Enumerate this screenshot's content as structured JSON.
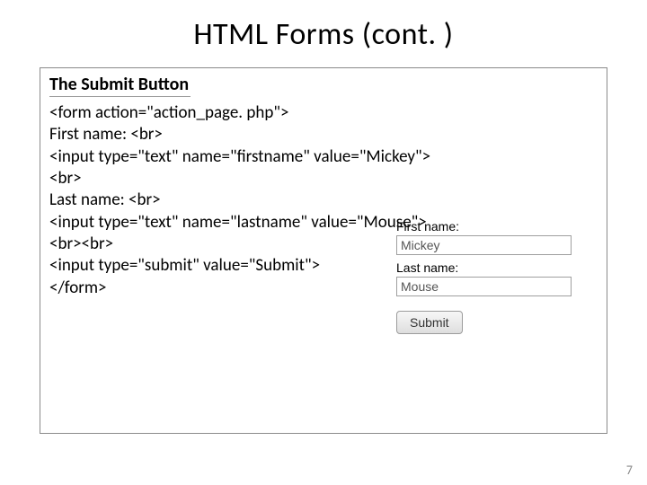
{
  "title": "HTML Forms (cont. )",
  "subheading": "The Submit Button",
  "code": {
    "l1": "<form action=\"action_page. php\">",
    "l2": "First name: <br>",
    "l3": "<input type=\"text\" name=\"firstname\" value=\"Mickey\">",
    "l4": "<br>",
    "l5": "Last name: <br>",
    "l6": "<input type=\"text\" name=\"lastname\" value=\"Mouse\">",
    "l7": "<br><br>",
    "l8": "<input type=\"submit\" value=\"Submit\">",
    "l9": "</form>"
  },
  "form": {
    "first_label": "First name:",
    "first_value": "Mickey",
    "last_label": "Last name:",
    "last_value": "Mouse",
    "submit_label": "Submit"
  },
  "page_number": "7"
}
